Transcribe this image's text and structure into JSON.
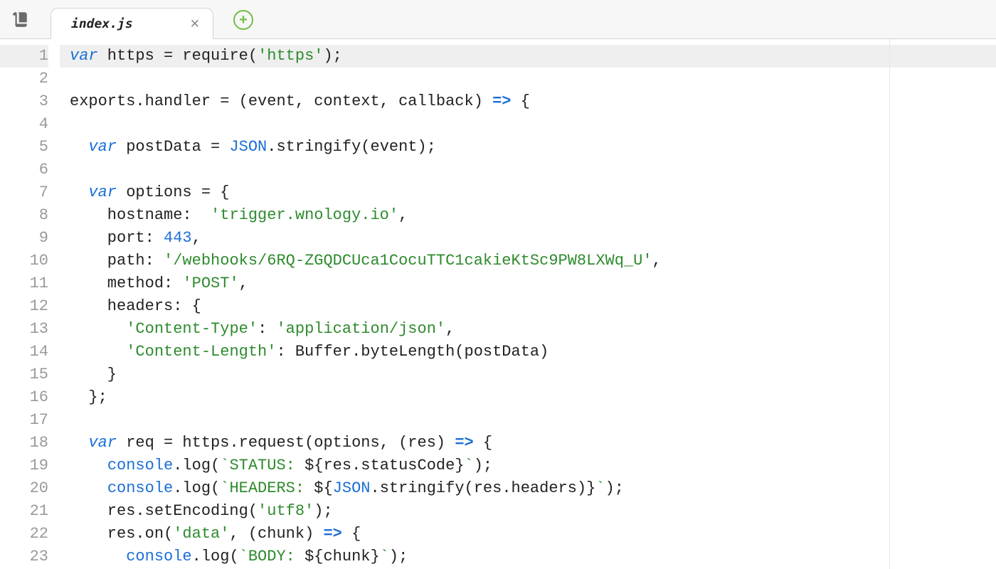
{
  "tab": {
    "label": "index.js"
  },
  "gutter": {
    "start": 1,
    "end": 23
  },
  "code": {
    "lines": [
      {
        "n": 1,
        "active": true,
        "tokens": [
          [
            "kw",
            "var"
          ],
          [
            "plain",
            " https "
          ],
          [
            "plain",
            "="
          ],
          [
            "plain",
            " require("
          ],
          [
            "str",
            "'https'"
          ],
          [
            "plain",
            ");"
          ]
        ]
      },
      {
        "n": 2,
        "tokens": []
      },
      {
        "n": 3,
        "tokens": [
          [
            "plain",
            "exports.handler "
          ],
          [
            "plain",
            "="
          ],
          [
            "plain",
            " (event, context, callback) "
          ],
          [
            "arrow",
            "=>"
          ],
          [
            "plain",
            " {"
          ]
        ]
      },
      {
        "n": 4,
        "tokens": []
      },
      {
        "n": 5,
        "tokens": [
          [
            "plain",
            "  "
          ],
          [
            "kw",
            "var"
          ],
          [
            "plain",
            " postData "
          ],
          [
            "plain",
            "="
          ],
          [
            "plain",
            " "
          ],
          [
            "builtin",
            "JSON"
          ],
          [
            "plain",
            ".stringify(event);"
          ]
        ]
      },
      {
        "n": 6,
        "tokens": []
      },
      {
        "n": 7,
        "tokens": [
          [
            "plain",
            "  "
          ],
          [
            "kw",
            "var"
          ],
          [
            "plain",
            " options "
          ],
          [
            "plain",
            "="
          ],
          [
            "plain",
            " {"
          ]
        ]
      },
      {
        "n": 8,
        "tokens": [
          [
            "plain",
            "    hostname:  "
          ],
          [
            "str",
            "'trigger.wnology.io'"
          ],
          [
            "plain",
            ","
          ]
        ]
      },
      {
        "n": 9,
        "tokens": [
          [
            "plain",
            "    port: "
          ],
          [
            "num",
            "443"
          ],
          [
            "plain",
            ","
          ]
        ]
      },
      {
        "n": 10,
        "tokens": [
          [
            "plain",
            "    path: "
          ],
          [
            "str",
            "'/webhooks/6RQ-ZGQDCUca1CocuTTC1cakieKtSc9PW8LXWq_U'"
          ],
          [
            "plain",
            ","
          ]
        ]
      },
      {
        "n": 11,
        "tokens": [
          [
            "plain",
            "    method: "
          ],
          [
            "str",
            "'POST'"
          ],
          [
            "plain",
            ","
          ]
        ]
      },
      {
        "n": 12,
        "tokens": [
          [
            "plain",
            "    headers: {"
          ]
        ]
      },
      {
        "n": 13,
        "tokens": [
          [
            "plain",
            "      "
          ],
          [
            "str",
            "'Content-Type'"
          ],
          [
            "plain",
            ": "
          ],
          [
            "str",
            "'application/json'"
          ],
          [
            "plain",
            ","
          ]
        ]
      },
      {
        "n": 14,
        "tokens": [
          [
            "plain",
            "      "
          ],
          [
            "str",
            "'Content-Length'"
          ],
          [
            "plain",
            ": Buffer.byteLength(postData)"
          ]
        ]
      },
      {
        "n": 15,
        "tokens": [
          [
            "plain",
            "    }"
          ]
        ]
      },
      {
        "n": 16,
        "tokens": [
          [
            "plain",
            "  };"
          ]
        ]
      },
      {
        "n": 17,
        "tokens": []
      },
      {
        "n": 18,
        "tokens": [
          [
            "plain",
            "  "
          ],
          [
            "kw",
            "var"
          ],
          [
            "plain",
            " req "
          ],
          [
            "plain",
            "="
          ],
          [
            "plain",
            " https.request(options, (res) "
          ],
          [
            "arrow",
            "=>"
          ],
          [
            "plain",
            " {"
          ]
        ]
      },
      {
        "n": 19,
        "tokens": [
          [
            "plain",
            "    "
          ],
          [
            "prop",
            "console"
          ],
          [
            "plain",
            ".log("
          ],
          [
            "str",
            "`STATUS: "
          ],
          [
            "plain",
            "${res.statusCode}"
          ],
          [
            "str",
            "`"
          ],
          [
            "plain",
            ");"
          ]
        ]
      },
      {
        "n": 20,
        "tokens": [
          [
            "plain",
            "    "
          ],
          [
            "prop",
            "console"
          ],
          [
            "plain",
            ".log("
          ],
          [
            "str",
            "`HEADERS: "
          ],
          [
            "plain",
            "${"
          ],
          [
            "builtin",
            "JSON"
          ],
          [
            "plain",
            ".stringify(res.headers)}"
          ],
          [
            "str",
            "`"
          ],
          [
            "plain",
            ");"
          ]
        ]
      },
      {
        "n": 21,
        "tokens": [
          [
            "plain",
            "    res.setEncoding("
          ],
          [
            "str",
            "'utf8'"
          ],
          [
            "plain",
            ");"
          ]
        ]
      },
      {
        "n": 22,
        "tokens": [
          [
            "plain",
            "    res.on("
          ],
          [
            "str",
            "'data'"
          ],
          [
            "plain",
            ", (chunk) "
          ],
          [
            "arrow",
            "=>"
          ],
          [
            "plain",
            " {"
          ]
        ]
      },
      {
        "n": 23,
        "tokens": [
          [
            "plain",
            "      "
          ],
          [
            "prop",
            "console"
          ],
          [
            "plain",
            ".log("
          ],
          [
            "str",
            "`BODY: "
          ],
          [
            "plain",
            "${chunk}"
          ],
          [
            "str",
            "`"
          ],
          [
            "plain",
            ");"
          ]
        ]
      }
    ]
  }
}
